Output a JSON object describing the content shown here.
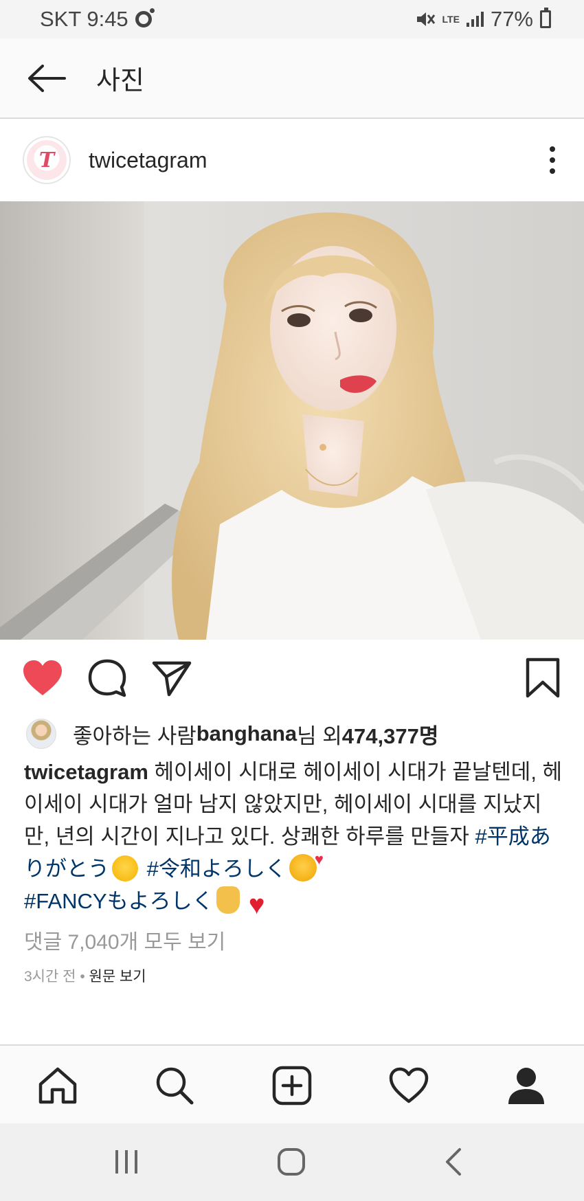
{
  "status_bar": {
    "carrier_time": "SKT 9:45",
    "network": "LTE",
    "battery": "77%"
  },
  "header": {
    "title": "사진"
  },
  "post": {
    "username": "twicetagram",
    "avatar_text": "T",
    "likes": {
      "prefix": "좋아하는 사람 ",
      "liker": "banghana",
      "middle": "님 외 ",
      "count": "474,377명"
    },
    "caption": {
      "username": "twicetagram",
      "text": " 헤이세이 시대로 헤이세이 시대가 끝날텐데, 헤이세이 시대가 얼마 남지 않았지만, 헤이세이 시대를 지났지만, 년의 시간이 지나고 있다. 상쾌한 하루를 만들자 ",
      "tag1": "#平成ありがとう",
      "tag2": "#令和よろしく",
      "tag3": "#FANCYもよろしく"
    },
    "comments_link": "댓글 7,040개 모두 보기",
    "time": "3시간 전",
    "separator": " • ",
    "original_link": "원문 보기"
  },
  "colors": {
    "like_red": "#ed4956",
    "hashtag": "#003569",
    "muted": "#999999"
  },
  "icons": {
    "back": "arrow-left-icon",
    "more": "more-vertical-icon",
    "like": "heart-filled-icon",
    "comment": "comment-icon",
    "share": "send-icon",
    "save": "bookmark-icon",
    "home": "home-icon",
    "search": "search-icon",
    "add": "add-post-icon",
    "activity": "heart-outline-icon",
    "profile": "profile-icon",
    "recents": "recents-icon",
    "android_home": "android-home-icon",
    "android_back": "android-back-icon"
  }
}
